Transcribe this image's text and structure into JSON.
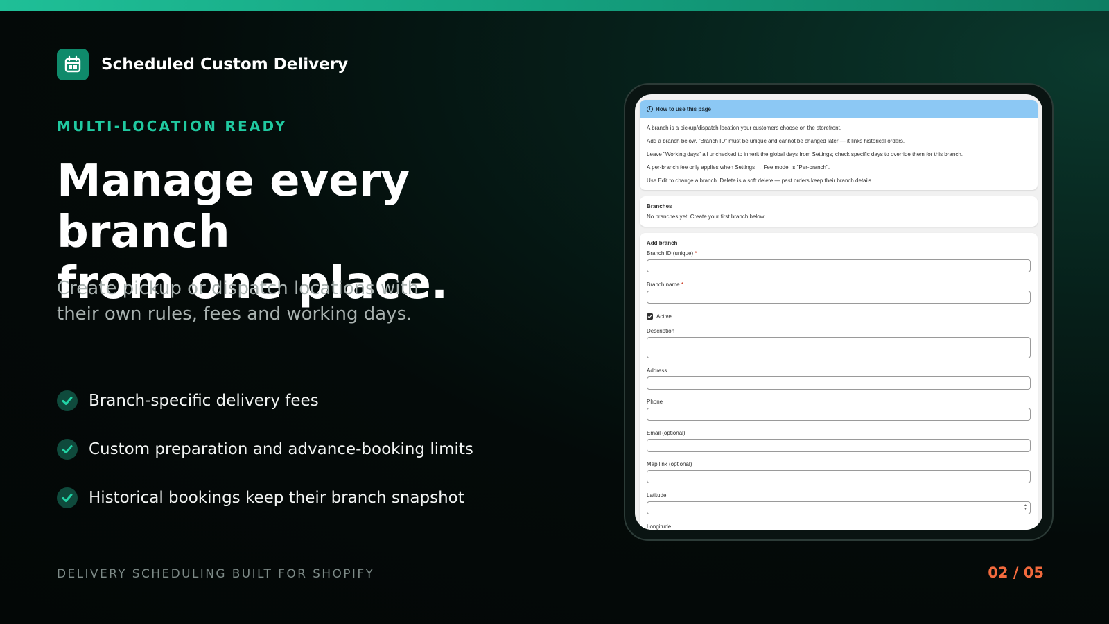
{
  "brand": {
    "name": "Scheduled Custom Delivery",
    "icon": "calendar-icon"
  },
  "eyebrow": "MULTI-LOCATION READY",
  "headline": {
    "line1": "Manage every branch",
    "line2": "from one place."
  },
  "subtext": {
    "line1": "Create pickup or dispatch locations with",
    "line2": "their own rules, fees and working days."
  },
  "features": [
    "Branch-specific delivery fees",
    "Custom preparation and advance-booking limits",
    "Historical bookings keep their branch snapshot"
  ],
  "footer": {
    "tagline": "DELIVERY SCHEDULING BUILT FOR SHOPIFY",
    "page": "02 / 05"
  },
  "colors": {
    "accent": "#20c9a0",
    "page_number": "#f26a3d",
    "info_banner": "#8cc8f4"
  },
  "app": {
    "info": {
      "title": "How to use this page",
      "lines": [
        "A branch is a pickup/dispatch location your customers choose on the storefront.",
        "Add a branch below. \"Branch ID\" must be unique and cannot be changed later — it links historical orders.",
        "Leave \"Working days\" all unchecked to inherit the global days from Settings; check specific days to override them for this branch.",
        "A per-branch fee only applies when Settings → Fee model is \"Per-branch\".",
        "Use Edit to change a branch. Delete is a soft delete — past orders keep their branch details."
      ]
    },
    "branches": {
      "title": "Branches",
      "empty": "No branches yet. Create your first branch below."
    },
    "form": {
      "title": "Add branch",
      "branch_id_label": "Branch ID (unique)",
      "branch_name_label": "Branch name",
      "required_mark": "*",
      "active_label": "Active",
      "active_checked": true,
      "description_label": "Description",
      "address_label": "Address",
      "phone_label": "Phone",
      "email_label": "Email (optional)",
      "map_label": "Map link (optional)",
      "latitude_label": "Latitude",
      "longitude_label": "Longitude"
    }
  }
}
